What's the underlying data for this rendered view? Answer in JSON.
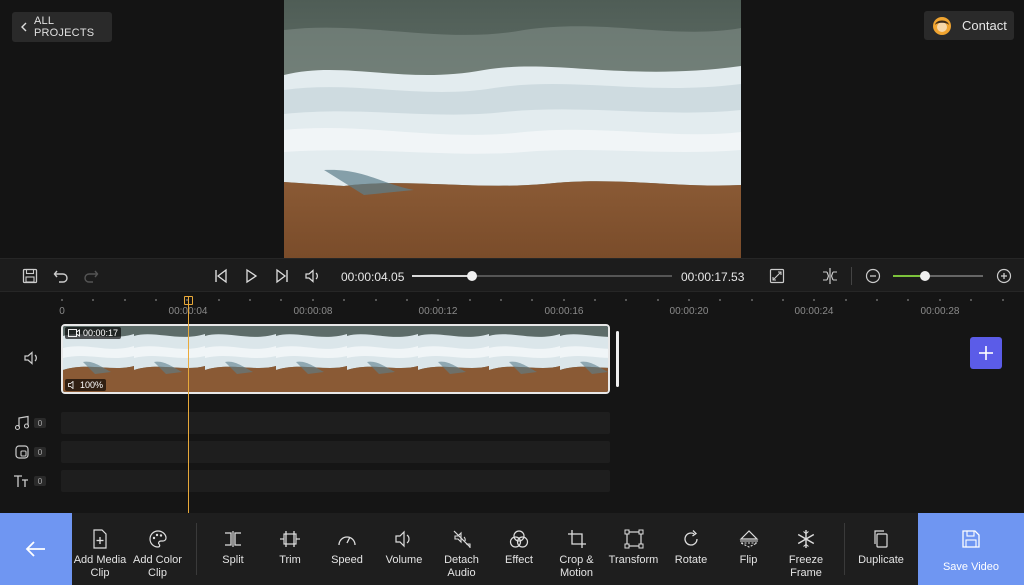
{
  "header": {
    "back_label": "ALL PROJECTS",
    "contact_label": "Contact"
  },
  "player": {
    "current_time": "00:00:04.05",
    "total_time": "00:00:17.53",
    "progress": 0.2311,
    "zoom_level": 0.35
  },
  "timeline": {
    "ruler_labels": [
      "0",
      "00:00:04",
      "00:00:08",
      "00:00:12",
      "00:00:16",
      "00:00:20",
      "00:00:24",
      "00:00:28"
    ],
    "clip": {
      "duration": "00:00:17",
      "volume": "100%"
    },
    "tracks": {
      "audio_count": "0",
      "overlay_count": "0",
      "text_count": "0"
    }
  },
  "toolbar": {
    "add_media_clip": "Add Media\nClip",
    "add_color_clip": "Add Color\nClip",
    "split": "Split",
    "trim": "Trim",
    "speed": "Speed",
    "volume": "Volume",
    "detach_audio": "Detach\nAudio",
    "effect": "Effect",
    "crop_motion": "Crop &\nMotion",
    "transform": "Transform",
    "rotate": "Rotate",
    "flip": "Flip",
    "freeze_frame": "Freeze\nFrame",
    "duplicate": "Duplicate",
    "save_video": "Save Video"
  },
  "colors": {
    "accent_blue": "#6f96f2",
    "add_button": "#5b5ce8",
    "playhead": "#e8a93a",
    "zoom_fill": "#7cc23b"
  }
}
